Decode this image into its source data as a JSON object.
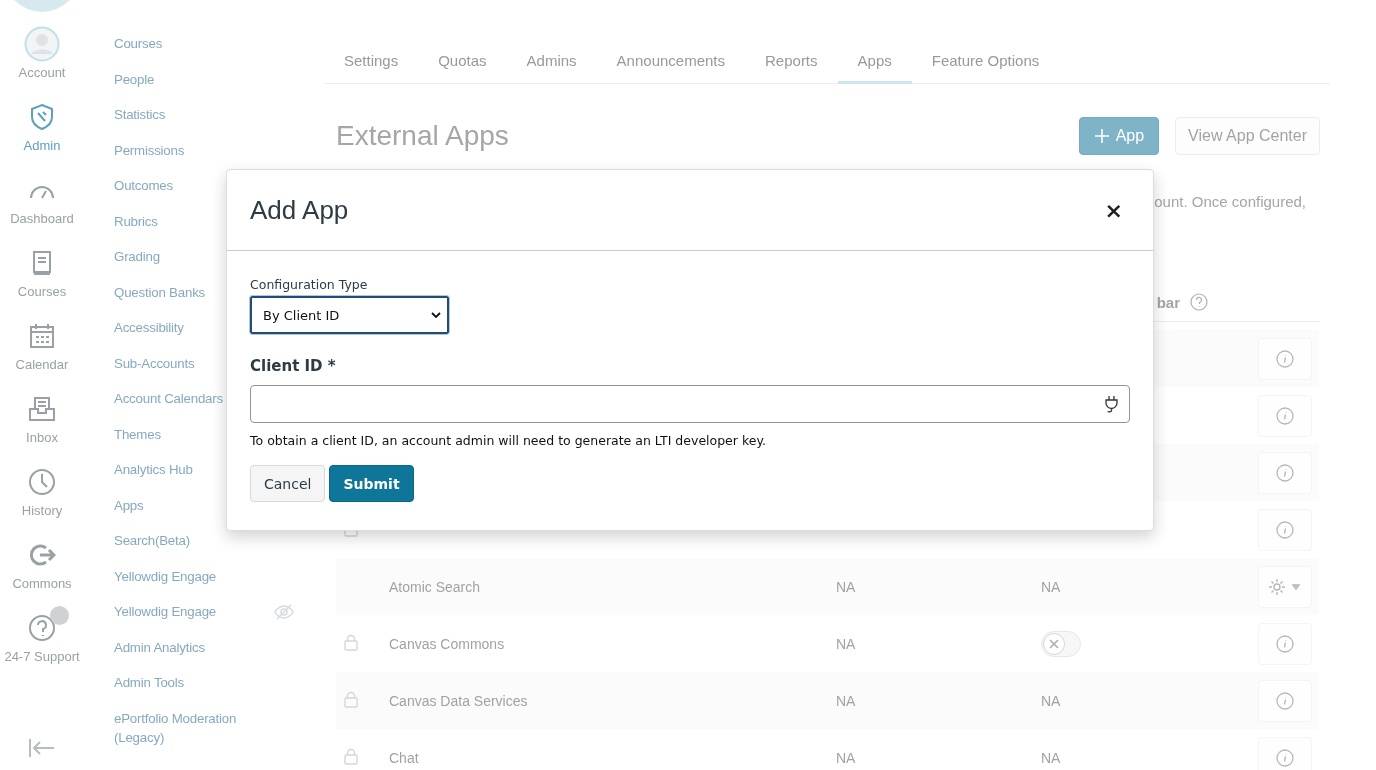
{
  "global_nav": {
    "items": [
      {
        "label": "Account",
        "selected": false,
        "badge": false
      },
      {
        "label": "Admin",
        "selected": true,
        "badge": false
      },
      {
        "label": "Dashboard",
        "selected": false,
        "badge": false
      },
      {
        "label": "Courses",
        "selected": false,
        "badge": false
      },
      {
        "label": "Calendar",
        "selected": false,
        "badge": false
      },
      {
        "label": "Inbox",
        "selected": false,
        "badge": false
      },
      {
        "label": "History",
        "selected": false,
        "badge": false
      },
      {
        "label": "Commons",
        "selected": false,
        "badge": false
      },
      {
        "label": "24-7 Support",
        "selected": false,
        "badge": true
      }
    ]
  },
  "account_nav": {
    "items": [
      {
        "label": "Courses",
        "hidden": false
      },
      {
        "label": "People",
        "hidden": false
      },
      {
        "label": "Statistics",
        "hidden": false
      },
      {
        "label": "Permissions",
        "hidden": false
      },
      {
        "label": "Outcomes",
        "hidden": false
      },
      {
        "label": "Rubrics",
        "hidden": false
      },
      {
        "label": "Grading",
        "hidden": false
      },
      {
        "label": "Question Banks",
        "hidden": false
      },
      {
        "label": "Accessibility",
        "hidden": false
      },
      {
        "label": "Sub-Accounts",
        "hidden": false
      },
      {
        "label": "Account Calendars",
        "hidden": false
      },
      {
        "label": "Themes",
        "hidden": false
      },
      {
        "label": "Analytics Hub",
        "hidden": false
      },
      {
        "label": "Apps",
        "hidden": false
      },
      {
        "label": "Search(Beta)",
        "hidden": false
      },
      {
        "label": "Yellowdig Engage",
        "hidden": false
      },
      {
        "label": "Yellowdig Engage",
        "hidden": true
      },
      {
        "label": "Admin Analytics",
        "hidden": false
      },
      {
        "label": "Admin Tools",
        "hidden": false
      },
      {
        "label": "ePortfolio Moderation (Legacy)",
        "hidden": false
      }
    ]
  },
  "tabs": [
    {
      "label": "Settings",
      "selected": false
    },
    {
      "label": "Quotas",
      "selected": false
    },
    {
      "label": "Admins",
      "selected": false
    },
    {
      "label": "Announcements",
      "selected": false
    },
    {
      "label": "Reports",
      "selected": false
    },
    {
      "label": "Apps",
      "selected": true
    },
    {
      "label": "Feature Options",
      "selected": false
    }
  ],
  "page": {
    "title": "External Apps",
    "add_button": "App",
    "app_center_button": "View App Center",
    "description_visible": "ount. Once configured,"
  },
  "table": {
    "header_visible": "bar",
    "rows": [
      {
        "locked": false,
        "kind": "info"
      },
      {
        "locked": false,
        "kind": "info"
      },
      {
        "locked": false,
        "kind": "info"
      },
      {
        "locked": true,
        "kind": "info"
      },
      {
        "locked": false,
        "name": "Atomic Search",
        "column_2": "NA",
        "column_3": {
          "kind": "text",
          "text": "NA"
        },
        "kind": "settings"
      },
      {
        "locked": true,
        "name": "Canvas Commons",
        "column_2": "NA",
        "column_3": {
          "kind": "toggle",
          "on": false
        },
        "kind": "info"
      },
      {
        "locked": true,
        "name": "Canvas Data Services",
        "column_2": "NA",
        "column_3": {
          "kind": "text",
          "text": "NA"
        },
        "kind": "info"
      },
      {
        "locked": true,
        "name": "Chat",
        "column_2": "NA",
        "column_3": {
          "kind": "text",
          "text": "NA"
        },
        "kind": "info"
      }
    ]
  },
  "dialog": {
    "title": "Add App",
    "close": "×",
    "config_label": "Configuration Type",
    "config_value": "By Client ID",
    "client_id_label": "Client ID *",
    "help": "To obtain a client ID, an account admin will need to generate an LTI developer key.",
    "buttons": [
      {
        "label": "Cancel",
        "kind": "secondary"
      },
      {
        "label": "Submit",
        "kind": "primary"
      }
    ]
  }
}
